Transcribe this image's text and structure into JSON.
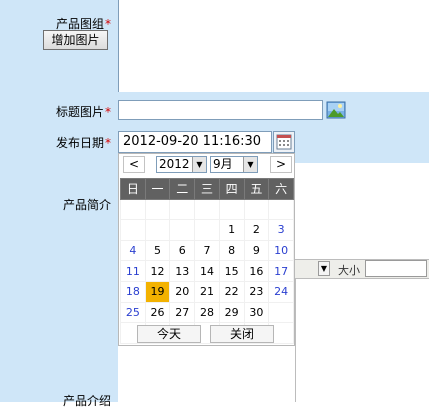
{
  "form": {
    "group_label": "产品图组",
    "add_image_label": "增加图片",
    "title_image_label": "标题图片",
    "publish_date_label": "发布日期",
    "publish_date_value": "2012-09-20 11:16:30",
    "intro_label": "产品简介",
    "detail_label": "产品介绍",
    "required_mark": "*"
  },
  "editor": {
    "size_label": "大小",
    "dropdown_arrow": "▼"
  },
  "calendar": {
    "prev": "<",
    "next": ">",
    "year": "2012",
    "month": "9月",
    "weekdays": [
      "日",
      "一",
      "二",
      "三",
      "四",
      "五",
      "六"
    ],
    "weeks": [
      [
        "",
        "",
        "",
        "",
        "",
        "",
        ""
      ],
      [
        "",
        "",
        "",
        "",
        "1",
        "2",
        "3"
      ],
      [
        "4",
        "5",
        "6",
        "7",
        "8",
        "9",
        "10"
      ],
      [
        "11",
        "12",
        "13",
        "14",
        "15",
        "16",
        "17"
      ],
      [
        "18",
        "19",
        "20",
        "21",
        "22",
        "23",
        "24"
      ],
      [
        "25",
        "26",
        "27",
        "28",
        "29",
        "30",
        ""
      ],
      [
        "",
        "",
        "",
        "",
        "",
        "",
        ""
      ]
    ],
    "today_label": "今天",
    "close_label": "关闭",
    "selected_day": "19",
    "colors": {
      "header_bg": "#616161",
      "selected_bg": "#f3b200",
      "weekend_text": "#2a3fd0"
    }
  }
}
